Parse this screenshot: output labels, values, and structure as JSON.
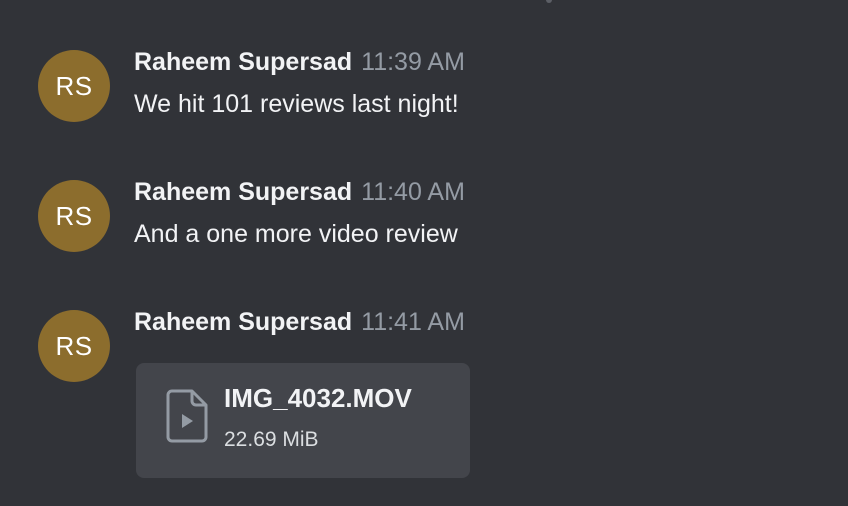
{
  "messages": [
    {
      "avatar_initials": "RS",
      "author": "Raheem Supersad",
      "timestamp": "11:39 AM",
      "text": "We hit 101 reviews last night!"
    },
    {
      "avatar_initials": "RS",
      "author": "Raheem Supersad",
      "timestamp": "11:40 AM",
      "text": "And a one more video review"
    },
    {
      "avatar_initials": "RS",
      "author": "Raheem Supersad",
      "timestamp": "11:41 AM",
      "attachment": {
        "icon": "video-file-icon",
        "file_name": "IMG_4032.MOV",
        "file_size": "22.69 MiB"
      }
    }
  ],
  "colors": {
    "background": "#313338",
    "avatar": "#8c6d2d",
    "attachment_background": "#43454b",
    "timestamp": "#949ba4",
    "text": "#f2f3f5"
  }
}
